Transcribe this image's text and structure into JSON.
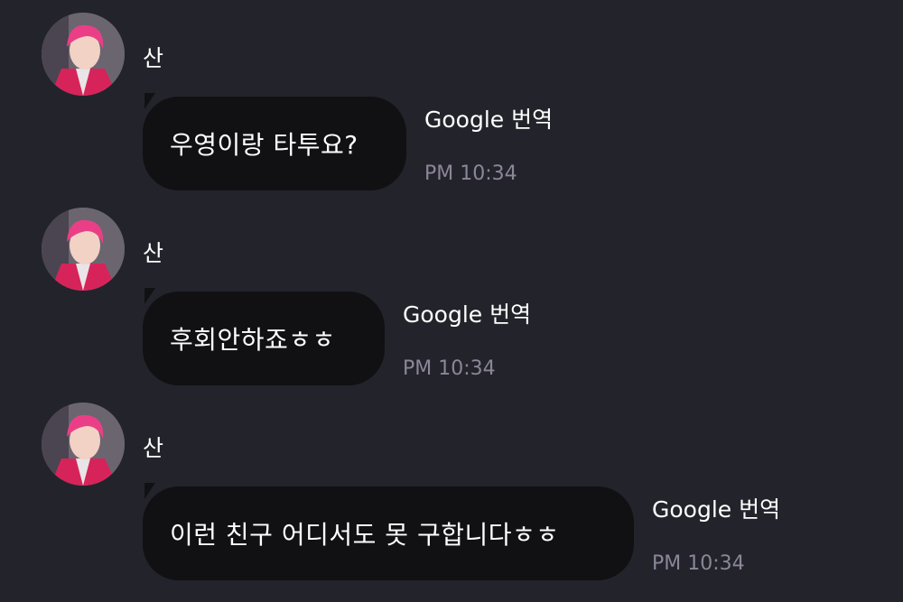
{
  "messages": [
    {
      "sender": "산",
      "text": "우영이랑 타투요?",
      "translate_label": "Google 번역",
      "time": "PM 10:34"
    },
    {
      "sender": "산",
      "text": "후회안하죠ㅎㅎ",
      "translate_label": "Google 번역",
      "time": "PM 10:34"
    },
    {
      "sender": "산",
      "text": "이런 친구 어디서도 못 구합니다ㅎㅎ",
      "translate_label": "Google 번역",
      "time": "PM 10:34"
    }
  ]
}
